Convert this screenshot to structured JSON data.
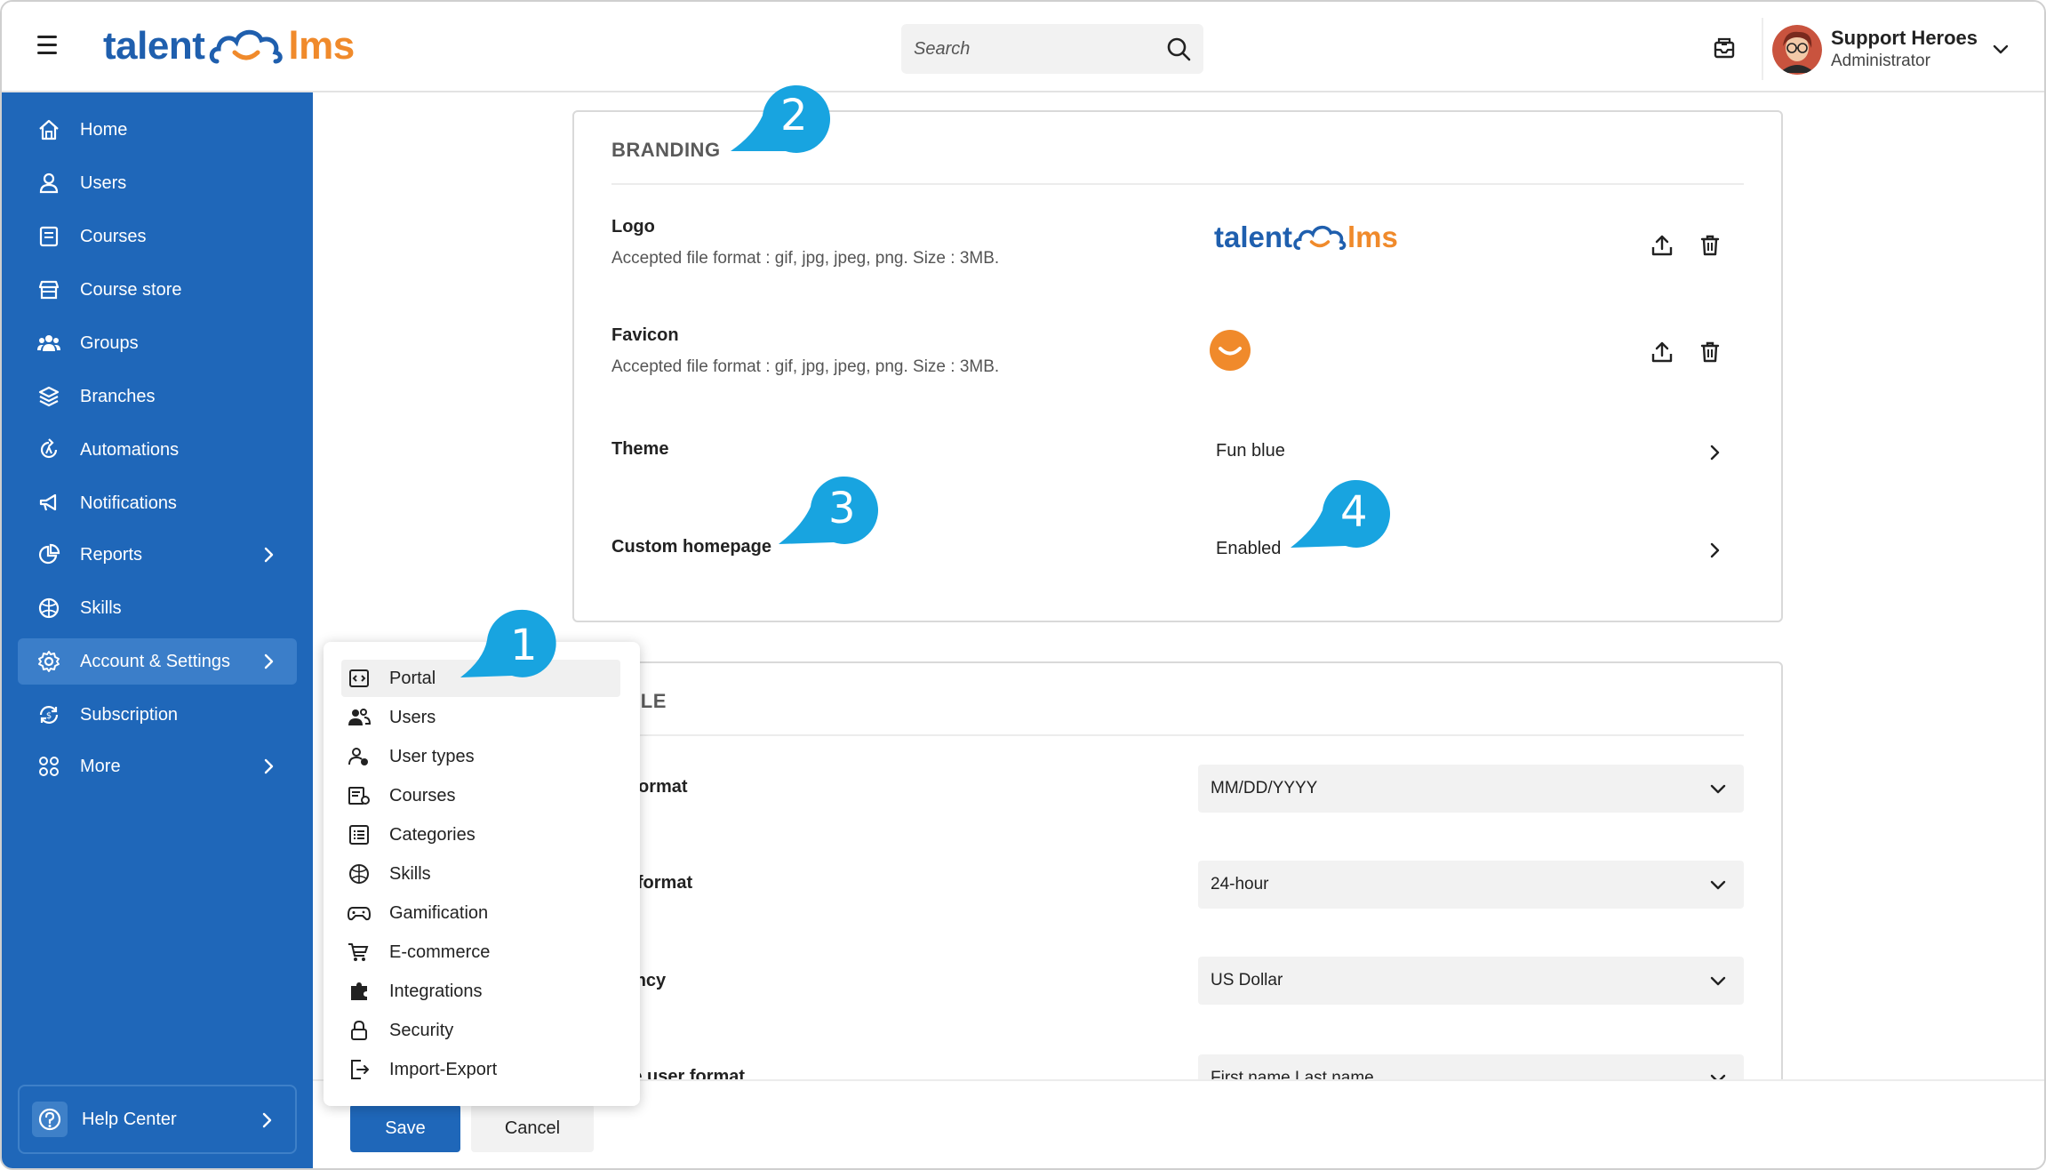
{
  "header": {
    "logo_left": "talent",
    "logo_right": "lms",
    "search_placeholder": "Search",
    "user_name": "Support Heroes",
    "user_role": "Administrator"
  },
  "sidebar": {
    "items": [
      {
        "label": "Home",
        "icon": "home-icon"
      },
      {
        "label": "Users",
        "icon": "user-icon"
      },
      {
        "label": "Courses",
        "icon": "book-icon"
      },
      {
        "label": "Course store",
        "icon": "store-icon"
      },
      {
        "label": "Groups",
        "icon": "groups-icon"
      },
      {
        "label": "Branches",
        "icon": "layers-icon"
      },
      {
        "label": "Automations",
        "icon": "automation-icon"
      },
      {
        "label": "Notifications",
        "icon": "megaphone-icon"
      },
      {
        "label": "Reports",
        "icon": "pie-chart-icon",
        "has_submenu": true
      },
      {
        "label": "Skills",
        "icon": "skills-icon"
      },
      {
        "label": "Account & Settings",
        "icon": "gear-icon",
        "has_submenu": true,
        "active": true
      },
      {
        "label": "Subscription",
        "icon": "subscription-icon"
      },
      {
        "label": "More",
        "icon": "grid-icon",
        "has_submenu": true
      }
    ],
    "help_center": "Help Center"
  },
  "submenu": {
    "items": [
      {
        "label": "Portal",
        "icon": "portal-icon",
        "active": true
      },
      {
        "label": "Users",
        "icon": "users-icon"
      },
      {
        "label": "User types",
        "icon": "user-types-icon"
      },
      {
        "label": "Courses",
        "icon": "courses-settings-icon"
      },
      {
        "label": "Categories",
        "icon": "categories-icon"
      },
      {
        "label": "Skills",
        "icon": "skills-icon"
      },
      {
        "label": "Gamification",
        "icon": "gamepad-icon"
      },
      {
        "label": "E-commerce",
        "icon": "cart-icon"
      },
      {
        "label": "Integrations",
        "icon": "puzzle-icon"
      },
      {
        "label": "Security",
        "icon": "lock-icon"
      },
      {
        "label": "Import-Export",
        "icon": "import-export-icon"
      }
    ]
  },
  "branding": {
    "title": "BRANDING",
    "logo_label": "Logo",
    "logo_desc": "Accepted file format : gif, jpg, jpeg, png. Size : 3MB.",
    "favicon_label": "Favicon",
    "favicon_desc": "Accepted file format : gif, jpg, jpeg, png. Size : 3MB.",
    "theme_label": "Theme",
    "theme_value": "Fun blue",
    "homepage_label": "Custom homepage",
    "homepage_value": "Enabled"
  },
  "locale": {
    "title": "CALE",
    "date_label": "te format",
    "date_value": "MM/DD/YYYY",
    "time_label": "ne format",
    "time_value": "24-hour",
    "currency_label": "rrency",
    "currency_value": "US Dollar",
    "user_format_label": "ible user format",
    "user_format_value": "First name Last name"
  },
  "footer": {
    "save": "Save",
    "cancel": "Cancel"
  },
  "callouts": [
    "1",
    "2",
    "3",
    "4"
  ],
  "colors": {
    "sidebar_bg": "#1f67b9",
    "brand_blue": "#1f5fae",
    "brand_orange": "#f08a2b",
    "callout_blue": "#18a4e0"
  }
}
